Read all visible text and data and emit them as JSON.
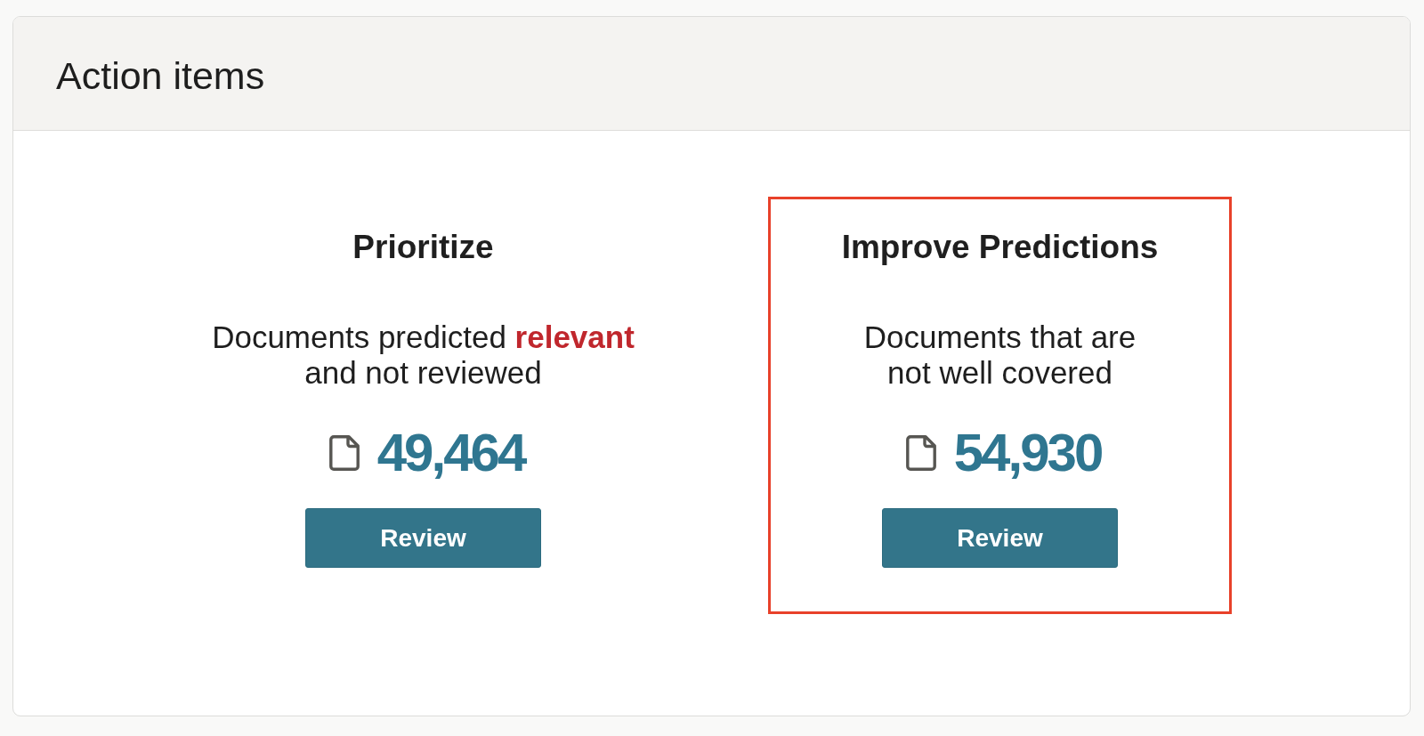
{
  "panel": {
    "title": "Action items"
  },
  "cards": [
    {
      "title": "Prioritize",
      "description": [
        "Documents predicted **relevant**",
        "and not reviewed"
      ],
      "count": "49,464",
      "button": "Review",
      "highlighted": false
    },
    {
      "title": "Improve Predictions",
      "description": [
        "Documents that are",
        "not well covered"
      ],
      "count": "54,930",
      "button": "Review",
      "highlighted": true
    }
  ]
}
